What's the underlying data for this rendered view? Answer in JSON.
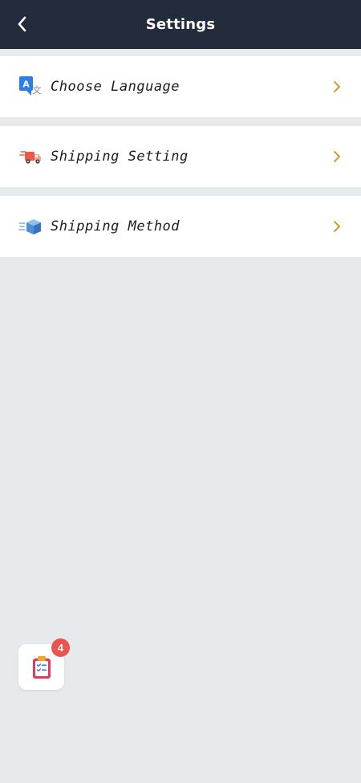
{
  "header": {
    "title": "Settings",
    "back_icon": "chevron-left-icon"
  },
  "menu": {
    "items": [
      {
        "label": "Choose Language",
        "icon": "translate-icon",
        "arrow_icon": "chevron-right-icon"
      },
      {
        "label": "Shipping Setting",
        "icon": "delivery-truck-icon",
        "arrow_icon": "chevron-right-icon"
      },
      {
        "label": "Shipping Method",
        "icon": "fast-box-icon",
        "arrow_icon": "chevron-right-icon"
      }
    ]
  },
  "floating_button": {
    "icon": "clipboard-checklist-icon",
    "badge_count": "4"
  },
  "colors": {
    "header_bg": "#232c3b",
    "page_bg": "#e7eaec",
    "arrow": "#d99a2b",
    "badge": "#e8554e"
  }
}
